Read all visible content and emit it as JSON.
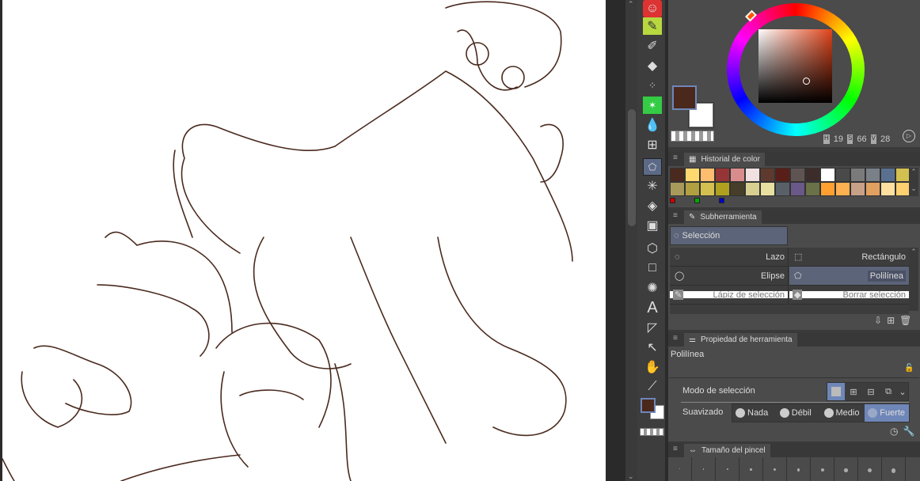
{
  "color": {
    "main": "#4a281c",
    "sub": "#ffffff",
    "h": "19",
    "s": "66",
    "v": "28",
    "h_label": "H",
    "s_label": "S",
    "v_label": "V"
  },
  "history": {
    "title": "Historial de color",
    "row1": [
      "#4a2a1e",
      "#ffd870",
      "#ffbd70",
      "#963535",
      "#d98c8c",
      "#f0e0e0",
      "#5e3a2e",
      "#5a1e18",
      "#605452",
      "#3c2c2a",
      "#ffffff",
      "#4a4a4a",
      "#7a7a7a",
      "#7a8088",
      "#5a7090",
      "#d4c050"
    ],
    "row2": [
      "#a89a5a",
      "#b0a040",
      "#d4c050",
      "#b0a020",
      "#463e28",
      "#d8d090",
      "#e8e0a0",
      "#5a6068",
      "#6a5888",
      "#6a7048",
      "#ffa030",
      "#ffb050",
      "#c8a088",
      "#e0a060",
      "#ffe0a0",
      "#ffd070"
    ],
    "markers": [
      "#cc0000",
      "#00aa00",
      "#0000cc"
    ]
  },
  "subtool": {
    "title": "Subherramienta",
    "group": "Selección",
    "items": [
      {
        "label": "Lazo"
      },
      {
        "label": "Rectángulo"
      },
      {
        "label": "Elipse"
      },
      {
        "label": "Polilínea"
      },
      {
        "label": "Lápiz de selección"
      },
      {
        "label": "Borrar selección"
      }
    ]
  },
  "property": {
    "title": "Propiedad de herramienta",
    "tool_name": "Polilínea",
    "mode_label": "Modo de selección",
    "smooth_label": "Suavizado",
    "smooth_options": [
      "Nada",
      "Débil",
      "Medio",
      "Fuerte"
    ],
    "smooth_selected": "Fuerte"
  },
  "brush": {
    "title": "Tamaño del pincel"
  },
  "accent": "#6f87b8"
}
